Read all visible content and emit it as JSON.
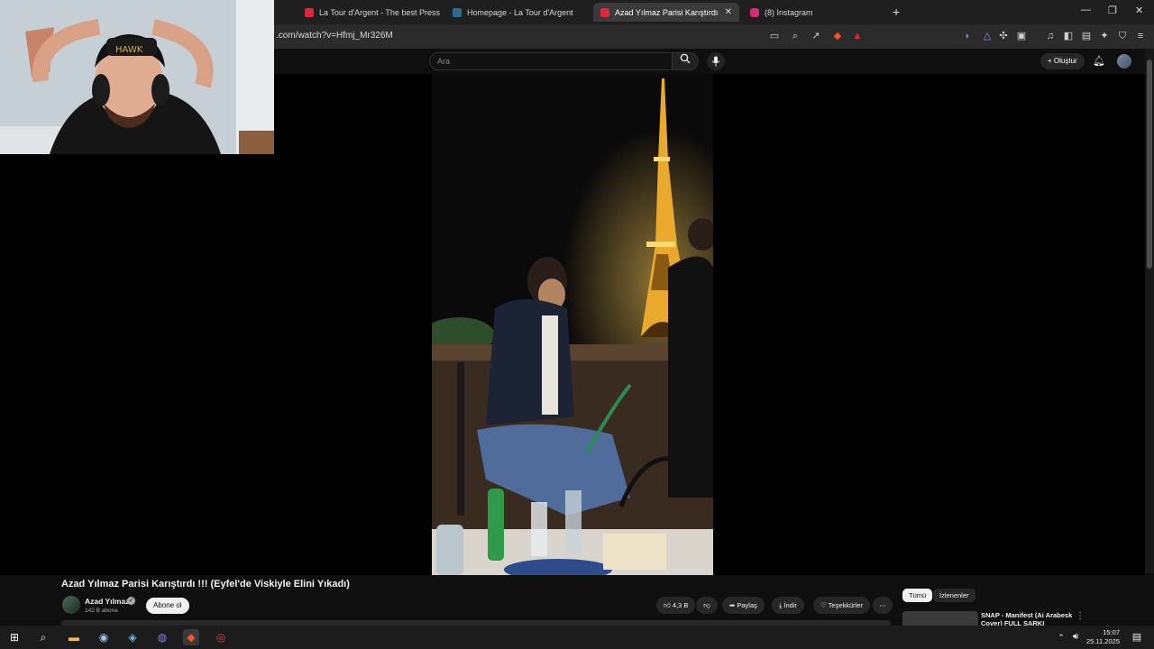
{
  "tabs": [
    {
      "label": "La Tour d'Argent - The best Pressed",
      "fav_color": "#e0263a"
    },
    {
      "label": "Homepage - La Tour d'Argent",
      "fav_color": "#2d6a8e"
    },
    {
      "label": "Azad Yılmaz Parisi Karıştırdı !!! (E",
      "fav_color": "#e0263a",
      "active": true
    },
    {
      "label": "(8) Instagram",
      "fav_color": "#d62976"
    }
  ],
  "address": {
    "url": ".com/watch?v=Hfmj_Mr326M"
  },
  "youtube": {
    "search_placeholder": "Ara",
    "create_label": "Oluştur"
  },
  "video": {
    "title": "Azad Yılmaz Parisi Karıştırdı !!! (Eyfel'de Viskiyle Elini Yıkadı)",
    "channel_name": "Azad Yılmaz",
    "subscribers": "142 B abone",
    "subscribe_label": "Abone ol",
    "likes": "4,3 B",
    "share_label": "Paylaş",
    "download_label": "İndir",
    "thanks_label": "Teşekkürler"
  },
  "filters": {
    "all": "Tümü",
    "watched": "İzlenenler"
  },
  "recommendation": {
    "title": "SNAP - Manifest (Ai Arabesk Cover) FULL ŞARKI"
  },
  "taskbar": {
    "time": "15:07",
    "date": "25.11.2025"
  }
}
